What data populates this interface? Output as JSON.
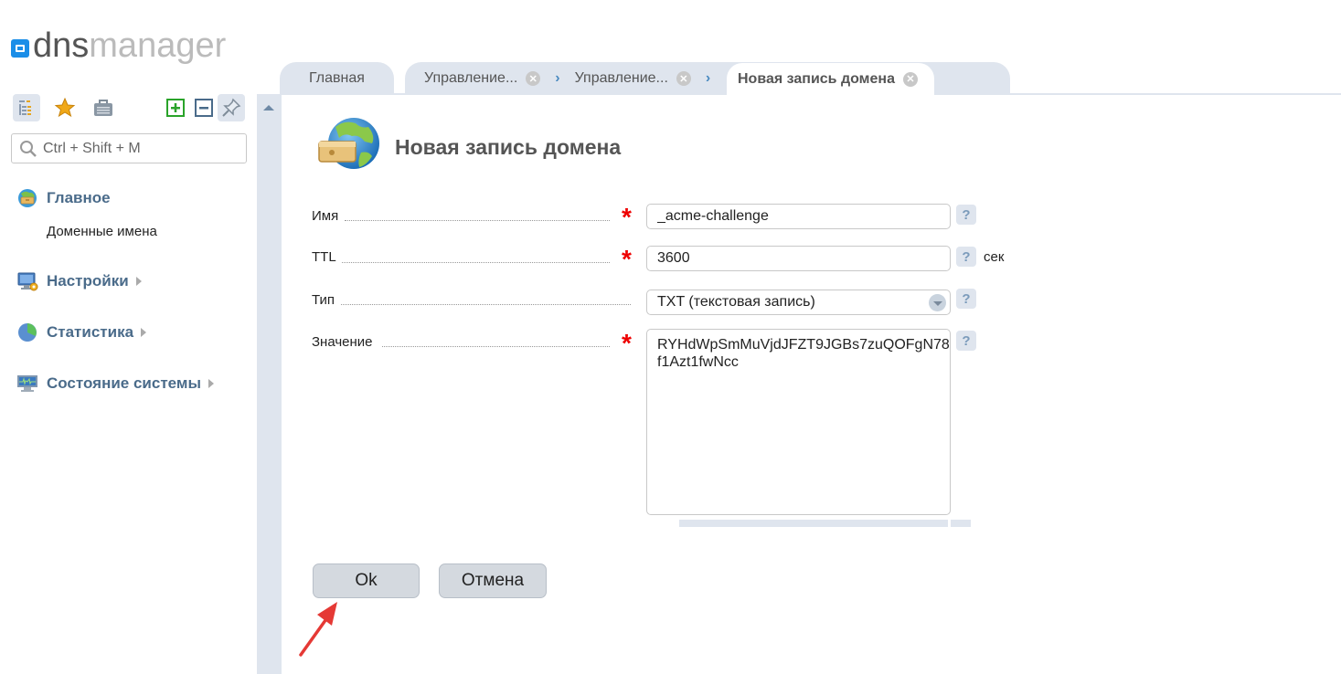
{
  "app": {
    "logo_dns": "dns",
    "logo_manager": "manager"
  },
  "sidebar": {
    "toolbar": {
      "tree_icon": "tree-view-icon",
      "favorites_icon": "star-icon",
      "briefcase_icon": "briefcase-icon",
      "expand_icon": "plus-icon",
      "collapse_icon": "minus-icon",
      "pin_icon": "pin-icon"
    },
    "search": {
      "placeholder": "Ctrl + Shift + M",
      "value": ""
    },
    "items": [
      {
        "label": "Главное",
        "icon": "home-globe-icon",
        "expandable": false,
        "children": [
          {
            "label": "Доменные имена"
          }
        ]
      },
      {
        "label": "Настройки",
        "icon": "settings-monitor-icon",
        "expandable": true
      },
      {
        "label": "Статистика",
        "icon": "pie-chart-icon",
        "expandable": true
      },
      {
        "label": "Состояние системы",
        "icon": "system-monitor-icon",
        "expandable": true
      }
    ]
  },
  "tabs": [
    {
      "label": "Главная",
      "closable": false,
      "active": false
    },
    {
      "label": "Управление...",
      "closable": true,
      "active": false
    },
    {
      "label": "Управление...",
      "closable": true,
      "active": false
    },
    {
      "label": "Новая запись домена",
      "closable": true,
      "active": true
    }
  ],
  "page": {
    "title": "Новая запись домена",
    "icon": "globe-drawer-icon"
  },
  "form": {
    "fields": [
      {
        "label": "Имя",
        "required": true,
        "type": "text",
        "value": "_acme-challenge",
        "help": "?"
      },
      {
        "label": "TTL",
        "required": true,
        "type": "text",
        "value": "3600",
        "help": "?",
        "unit": "сек"
      },
      {
        "label": "Тип",
        "required": false,
        "type": "select",
        "value": "TXT (текстовая запись)",
        "help": "?"
      },
      {
        "label": "Значение",
        "required": true,
        "type": "textarea",
        "value": "RYHdWpSmMuVjdJFZT9JGBs7zuQOFgN78f1Azt1fwNcc",
        "help": "?"
      }
    ],
    "required_mark": "*",
    "buttons": {
      "ok": "Ok",
      "cancel": "Отмена"
    }
  },
  "colors": {
    "accent": "#1b8ee8",
    "nav_text": "#4a6b8a",
    "required": "#ee0000",
    "panel": "#dfe5ee",
    "annotation_arrow": "#e53935"
  }
}
